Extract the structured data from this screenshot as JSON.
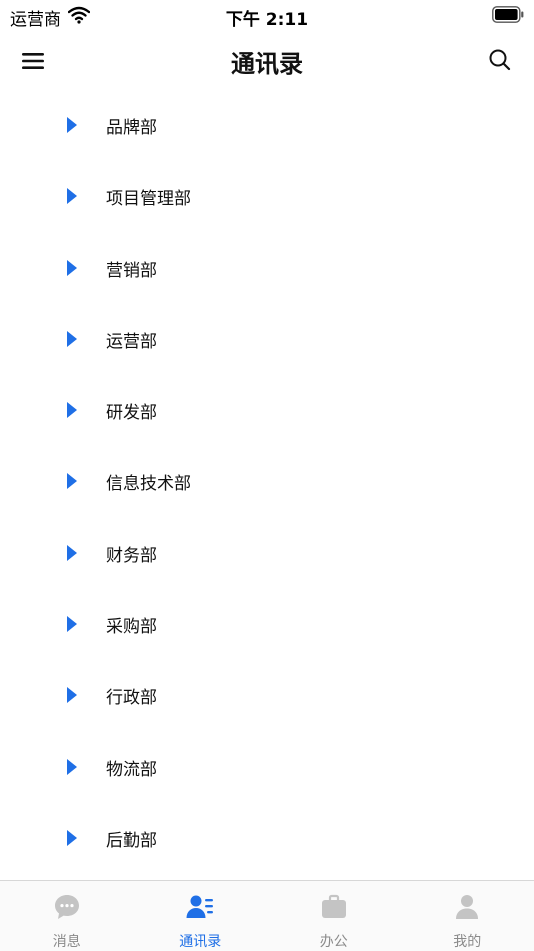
{
  "status_bar": {
    "carrier": "运营商",
    "time": "下午 2:11"
  },
  "navbar": {
    "title": "通讯录",
    "menu_icon": "hamburger-menu-icon",
    "search_icon": "search-icon"
  },
  "departments": [
    {
      "label": "品牌部"
    },
    {
      "label": "项目管理部"
    },
    {
      "label": "营销部"
    },
    {
      "label": "运营部"
    },
    {
      "label": "研发部"
    },
    {
      "label": "信息技术部"
    },
    {
      "label": "财务部"
    },
    {
      "label": "采购部"
    },
    {
      "label": "行政部"
    },
    {
      "label": "物流部"
    },
    {
      "label": "后勤部"
    }
  ],
  "tabs": [
    {
      "label": "消息",
      "icon": "chat-bubble-icon",
      "active": false
    },
    {
      "label": "通讯录",
      "icon": "contacts-icon",
      "active": true
    },
    {
      "label": "办公",
      "icon": "briefcase-icon",
      "active": false
    },
    {
      "label": "我的",
      "icon": "person-icon",
      "active": false
    }
  ],
  "colors": {
    "accent": "#1f6fe6",
    "arrow": "#1f6fe6",
    "inactive_tab": "#c4c4c4",
    "inactive_text": "#8a8a8a"
  }
}
